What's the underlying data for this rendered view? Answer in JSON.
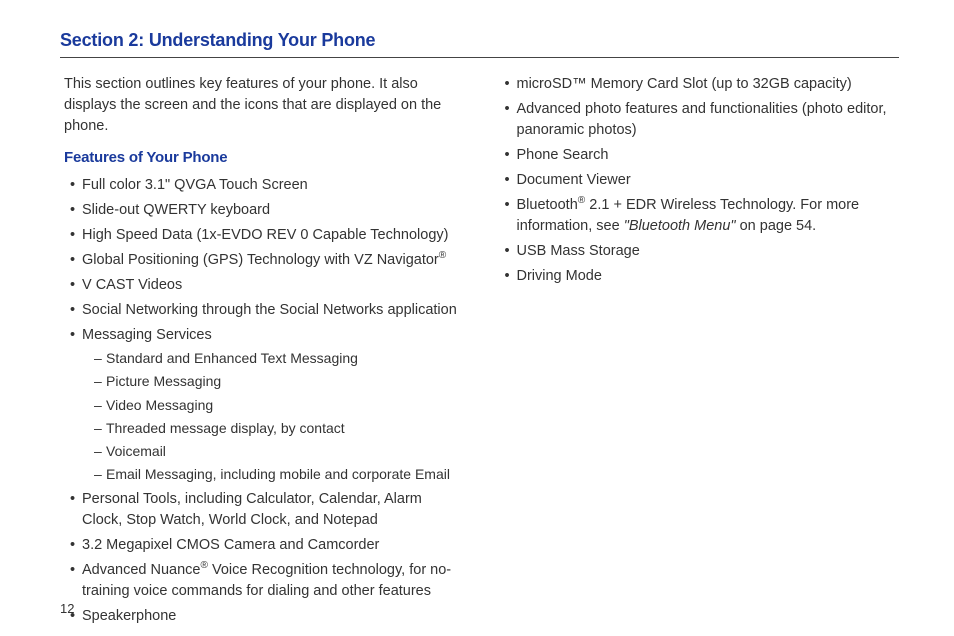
{
  "section_title": "Section 2: Understanding Your Phone",
  "intro": "This section outlines key features of your phone. It also displays the screen and the icons that are displayed on the phone.",
  "sub_heading": "Features of Your Phone",
  "col1": {
    "items": [
      "Full color 3.1\" QVGA Touch Screen",
      "Slide-out QWERTY keyboard",
      "High Speed Data (1x-EVDO REV 0 Capable Technology)",
      "V CAST Videos",
      "Social Networking through the Social Networks application",
      "Messaging Services",
      "Personal Tools, including Calculator, Calendar, Alarm Clock, Stop Watch, World Clock, and Notepad",
      "3.2 Megapixel CMOS Camera and Camcorder",
      "Speakerphone"
    ],
    "gps_pre": "Global Positioning (GPS) Technology with VZ Navigator",
    "nuance_pre": "Advanced Nuance",
    "nuance_post": " Voice Recognition technology, for no-training voice commands for dialing and other features",
    "sup_reg": "®",
    "msg_sub": [
      "Standard and Enhanced Text Messaging",
      "Picture Messaging",
      "Video Messaging",
      "Threaded message display, by contact",
      "Voicemail",
      "Email Messaging, including mobile and corporate Email"
    ]
  },
  "col2": {
    "items": [
      "microSD™ Memory Card Slot (up to 32GB capacity)",
      "Advanced photo features and functionalities (photo editor, panoramic photos)",
      "Phone Search",
      "Document Viewer",
      "USB Mass Storage",
      "Driving Mode"
    ],
    "bt_pre": "Bluetooth",
    "bt_mid": " 2.1 + EDR Wireless Technology. For more information, see ",
    "bt_ref": "\"Bluetooth Menu\"",
    "bt_post": " on page 54.",
    "sup_reg": "®"
  },
  "page_number": "12"
}
